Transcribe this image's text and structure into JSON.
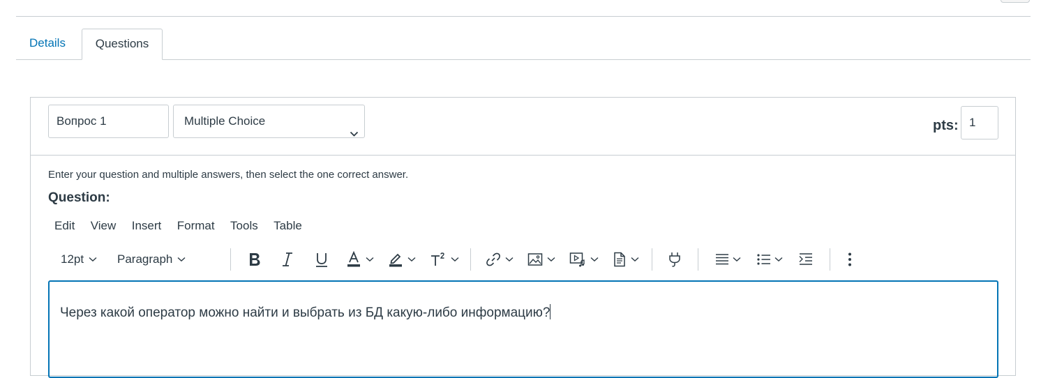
{
  "tabs": [
    {
      "label": "Details",
      "active": false
    },
    {
      "label": "Questions",
      "active": true
    }
  ],
  "question": {
    "name_value": "Вопрос 1",
    "type_selected": "Multiple Choice",
    "points_label": "pts:",
    "points_value": "1",
    "instruction": "Enter your question and multiple answers, then select the one correct answer.",
    "question_label": "Question:"
  },
  "editor": {
    "menu": [
      "Edit",
      "View",
      "Insert",
      "Format",
      "Tools",
      "Table"
    ],
    "font_size": "12pt",
    "block_format": "Paragraph",
    "toolbar_icons": [
      "bold-icon",
      "italic-icon",
      "underline-icon",
      "text-color-icon",
      "highlight-color-icon",
      "superscript-icon",
      "link-icon",
      "image-icon",
      "media-icon",
      "document-icon",
      "plugin-icon",
      "align-icon",
      "list-icon",
      "indent-icon",
      "more-icon"
    ],
    "content": "Через какой оператор можно найти и выбрать из БД какую-либо информацию?"
  },
  "colors": {
    "accent": "#0374b5",
    "text": "#2d3b45",
    "border": "#c7cdd1"
  }
}
